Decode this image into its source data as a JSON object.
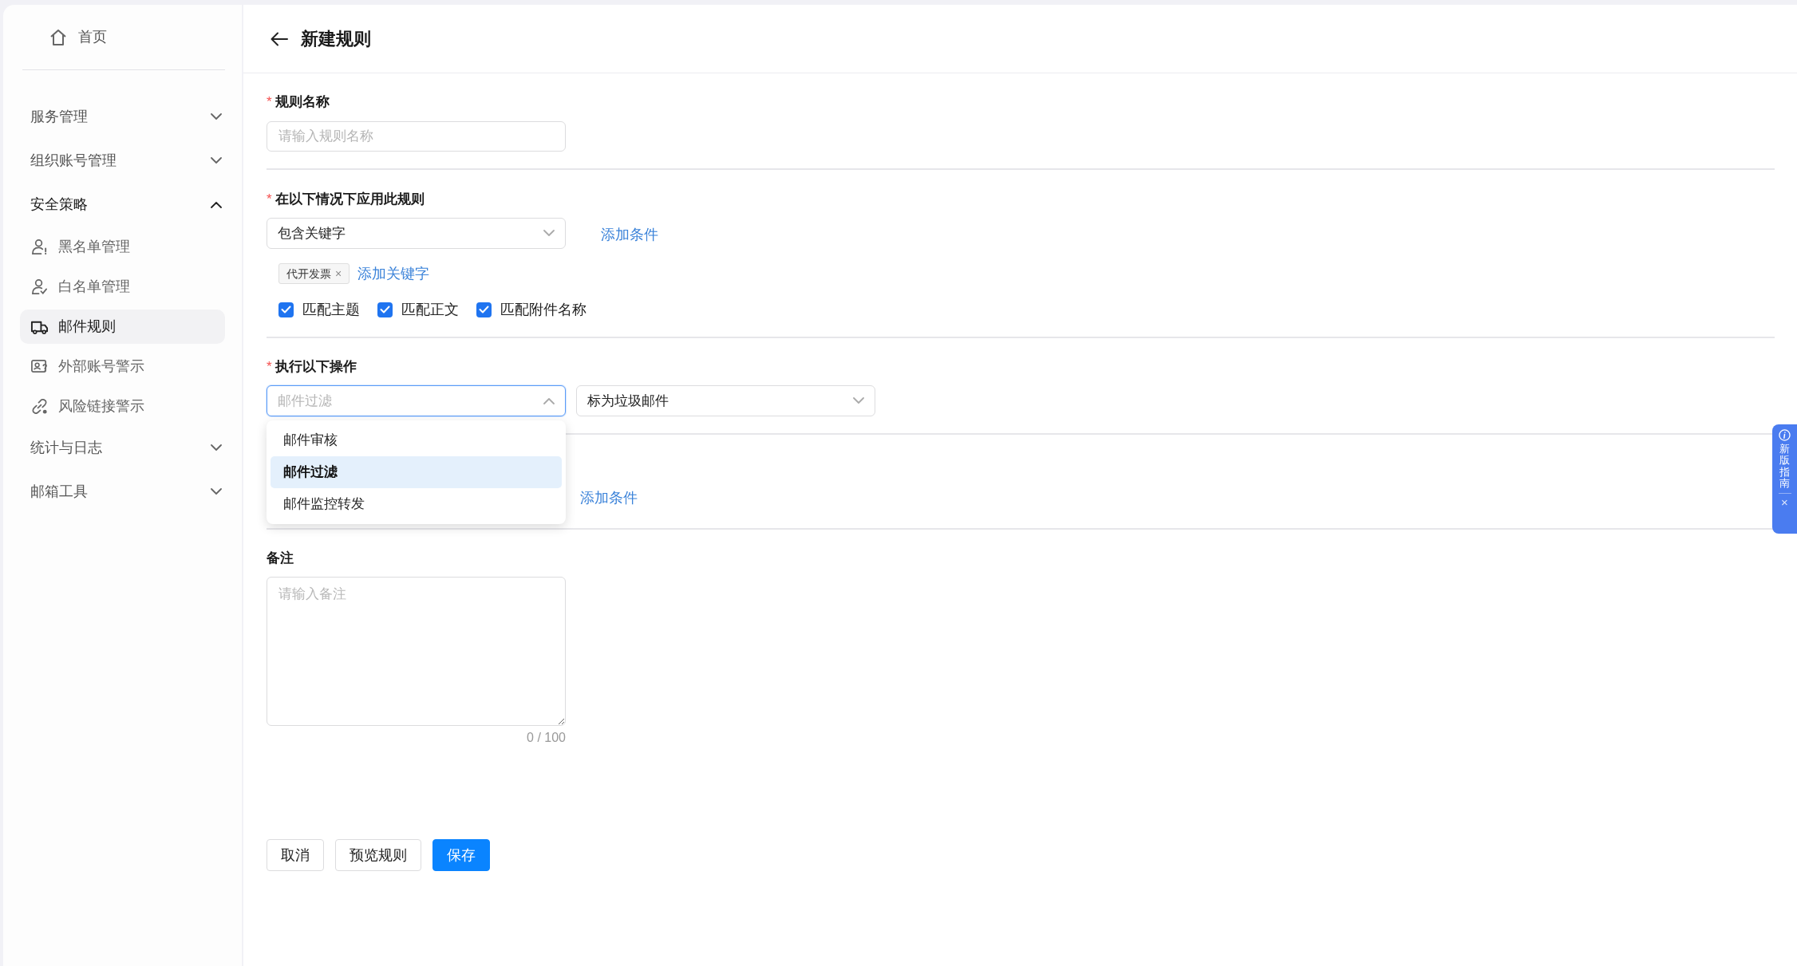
{
  "sidebar": {
    "home": {
      "label": "首页"
    },
    "groups": [
      {
        "label": "服务管理",
        "expanded": false
      },
      {
        "label": "组织账号管理",
        "expanded": false
      },
      {
        "label": "安全策略",
        "expanded": true,
        "children": [
          {
            "label": "黑名单管理",
            "selected": false
          },
          {
            "label": "白名单管理",
            "selected": false
          },
          {
            "label": "邮件规则",
            "selected": true
          },
          {
            "label": "外部账号警示",
            "selected": false
          },
          {
            "label": "风险链接警示",
            "selected": false
          }
        ]
      },
      {
        "label": "统计与日志",
        "expanded": false
      },
      {
        "label": "邮箱工具",
        "expanded": false
      }
    ]
  },
  "header": {
    "title": "新建规则"
  },
  "form": {
    "rule_name": {
      "marker": "*",
      "label": "规则名称",
      "placeholder": "请输入规则名称"
    },
    "conditions": {
      "marker": "*",
      "label": "在以下情况下应用此规则",
      "select": {
        "value": "包含关键字"
      },
      "add_condition_link": "添加条件",
      "keywords": [
        {
          "text": "代开发票",
          "remove": "×"
        }
      ],
      "add_keyword_link": "添加关键字",
      "options": [
        {
          "label": "匹配主题",
          "checked": true
        },
        {
          "label": "匹配正文",
          "checked": true
        },
        {
          "label": "匹配附件名称",
          "checked": true
        }
      ]
    },
    "actions": {
      "marker": "*",
      "label": "执行以下操作",
      "selects": [
        {
          "placeholder": "邮件过滤",
          "open": true
        },
        {
          "value": "标为垃圾邮件",
          "open": false
        }
      ],
      "dropdown": [
        {
          "label": "邮件审核",
          "selected": false
        },
        {
          "label": "邮件过滤",
          "selected": true
        },
        {
          "label": "邮件监控转发",
          "selected": false
        }
      ]
    },
    "extra_section": {
      "add_condition_link": "添加条件"
    },
    "remarks": {
      "label": "备注",
      "placeholder": "请输入备注",
      "counter": "0 / 100"
    },
    "buttons": [
      {
        "label": "取消",
        "kind": "default"
      },
      {
        "label": "预览规则",
        "kind": "default"
      },
      {
        "label": "保存",
        "kind": "primary"
      }
    ]
  },
  "guide_tab": {
    "label": "新版指南",
    "close": "×"
  }
}
